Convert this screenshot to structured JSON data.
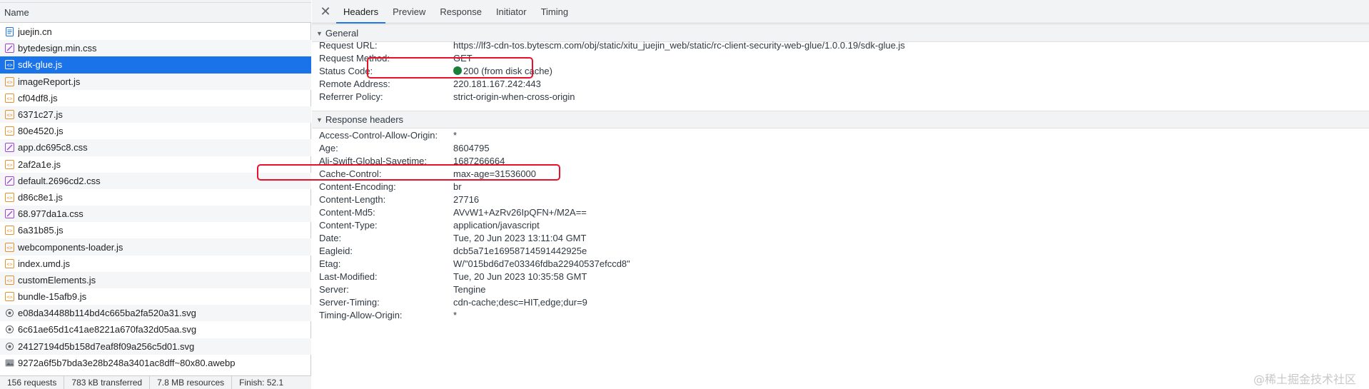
{
  "left_pane": {
    "header": "Name",
    "files": [
      {
        "name": "juejin.cn",
        "icon": "document-icon"
      },
      {
        "name": "bytedesign.min.css",
        "icon": "stylesheet-icon"
      },
      {
        "name": "sdk-glue.js",
        "icon": "script-icon"
      },
      {
        "name": "imageReport.js",
        "icon": "script-icon"
      },
      {
        "name": "cf04df8.js",
        "icon": "script-icon"
      },
      {
        "name": "6371c27.js",
        "icon": "script-icon"
      },
      {
        "name": "80e4520.js",
        "icon": "script-icon"
      },
      {
        "name": "app.dc695c8.css",
        "icon": "stylesheet-icon"
      },
      {
        "name": "2af2a1e.js",
        "icon": "script-icon"
      },
      {
        "name": "default.2696cd2.css",
        "icon": "stylesheet-icon"
      },
      {
        "name": "d86c8e1.js",
        "icon": "script-icon"
      },
      {
        "name": "68.977da1a.css",
        "icon": "stylesheet-icon"
      },
      {
        "name": "6a31b85.js",
        "icon": "script-icon"
      },
      {
        "name": "webcomponents-loader.js",
        "icon": "script-icon"
      },
      {
        "name": "index.umd.js",
        "icon": "script-icon"
      },
      {
        "name": "customElements.js",
        "icon": "script-icon"
      },
      {
        "name": "bundle-15afb9.js",
        "icon": "script-icon"
      },
      {
        "name": "e08da34488b114bd4c665ba2fa520a31.svg",
        "icon": "svg-image-icon"
      },
      {
        "name": "6c61ae65d1c41ae8221a670fa32d05aa.svg",
        "icon": "svg-image-icon"
      },
      {
        "name": "24127194d5b158d7eaf8f09a256c5d01.svg",
        "icon": "svg-image-icon"
      },
      {
        "name": "9272a6f5b7bda3e28b248a3401ac8dff~80x80.awebp",
        "icon": "image-icon"
      }
    ],
    "selected_file": "sdk-glue.js",
    "status_bar": {
      "requests": "156 requests",
      "transferred": "783 kB transferred",
      "resources": "7.8 MB resources",
      "finish": "Finish: 52.1"
    }
  },
  "right_pane": {
    "tabs": [
      "Headers",
      "Preview",
      "Response",
      "Initiator",
      "Timing"
    ],
    "active_tab": "Headers",
    "close_symbol": "✕",
    "general": {
      "title": "General",
      "rows": [
        {
          "key": "Request URL:",
          "value": "https://lf3-cdn-tos.bytescm.com/obj/static/xitu_juejin_web/static/rc-client-security-web-glue/1.0.0.19/sdk-glue.js"
        },
        {
          "key": "Request Method:",
          "value": "GET"
        },
        {
          "key": "Status Code:",
          "value": "200 (from disk cache)"
        },
        {
          "key": "Remote Address:",
          "value": "220.181.167.242:443"
        },
        {
          "key": "Referrer Policy:",
          "value": "strict-origin-when-cross-origin"
        }
      ]
    },
    "response_headers": {
      "title": "Response headers",
      "rows": [
        {
          "key": "Access-Control-Allow-Origin:",
          "value": "*"
        },
        {
          "key": "Age:",
          "value": "8604795"
        },
        {
          "key": "Ali-Swift-Global-Savetime:",
          "value": "1687266664"
        },
        {
          "key": "Cache-Control:",
          "value": "max-age=31536000"
        },
        {
          "key": "Content-Encoding:",
          "value": "br"
        },
        {
          "key": "Content-Length:",
          "value": "27716"
        },
        {
          "key": "Content-Md5:",
          "value": "AVvW1+AzRv26IpQFN+/M2A=="
        },
        {
          "key": "Content-Type:",
          "value": "application/javascript"
        },
        {
          "key": "Date:",
          "value": "Tue, 20 Jun 2023 13:11:04 GMT"
        },
        {
          "key": "Eagleid:",
          "value": "dcb5a71e16958714591442925e"
        },
        {
          "key": "Etag:",
          "value": "W/\"015bd6d7e03346fdba22940537efccd8\""
        },
        {
          "key": "Last-Modified:",
          "value": "Tue, 20 Jun 2023 10:35:58 GMT"
        },
        {
          "key": "Server:",
          "value": "Tengine"
        },
        {
          "key": "Server-Timing:",
          "value": "cdn-cache;desc=HIT,edge;dur=9"
        },
        {
          "key": "Timing-Allow-Origin:",
          "value": "*"
        }
      ]
    }
  },
  "watermark": "@稀土掘金技术社区",
  "colors": {
    "selected_row": "#1a73e8",
    "status_dot": "#188038",
    "highlight_box": "#e8102a",
    "script_icon": "#e8912a",
    "stylesheet_icon": "#a142d6",
    "document_icon": "#1a73e8"
  }
}
